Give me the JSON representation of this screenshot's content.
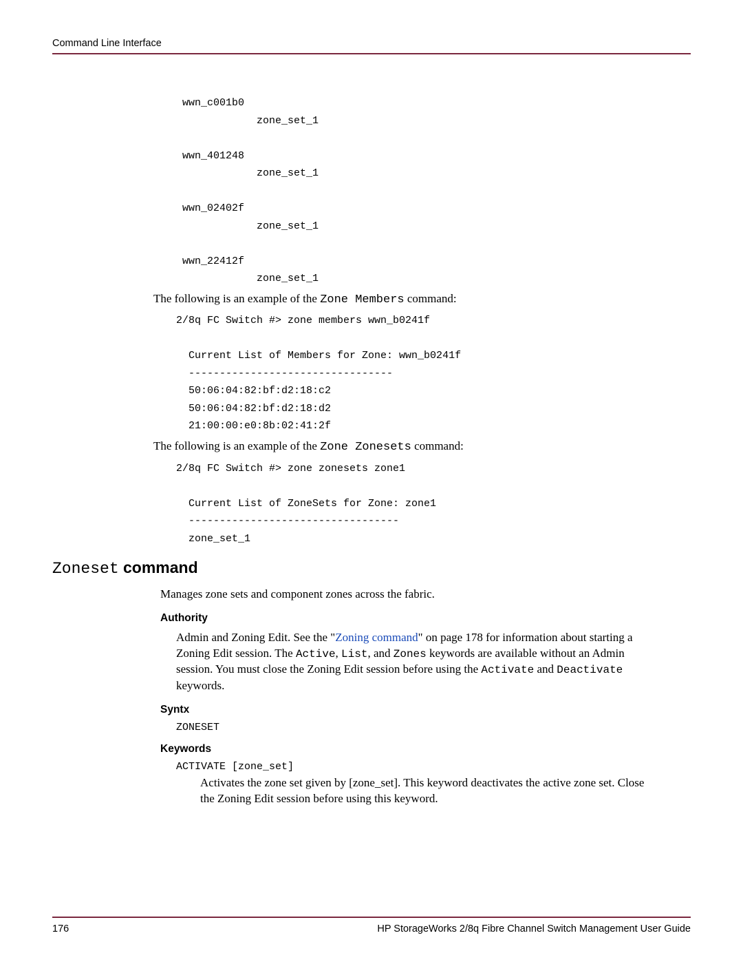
{
  "header": "Command Line Interface",
  "code_block_1": " wwn_c001b0\n             zone_set_1\n\n wwn_401248\n             zone_set_1\n\n wwn_02402f\n             zone_set_1\n\n wwn_22412f\n             zone_set_1",
  "para1_a": "The following is an example of the ",
  "para1_b": "Zone Members",
  "para1_c": " command:",
  "code_block_2": "2/8q FC Switch #> zone members wwn_b0241f\n\n  Current List of Members for Zone: wwn_b0241f\n  ---------------------------------\n  50:06:04:82:bf:d2:18:c2\n  50:06:04:82:bf:d2:18:d2\n  21:00:00:e0:8b:02:41:2f",
  "para2_a": "The following is an example of the ",
  "para2_b": "Zone Zonesets",
  "para2_c": " command:",
  "code_block_3": "2/8q FC Switch #> zone zonesets zone1\n\n  Current List of ZoneSets for Zone: zone1\n  ----------------------------------\n  zone_set_1",
  "section_mono": "Zoneset",
  "section_bold": " command",
  "section_intro": "Manages zone sets and component zones across the fabric.",
  "authority_h": "Authority",
  "authority_a": "Admin and Zoning Edit. See the \"",
  "authority_link": "Zoning command",
  "authority_b": "\" on page 178 for information about starting a Zoning Edit session. The ",
  "authority_m1": "Active",
  "authority_c": ", ",
  "authority_m2": "List",
  "authority_d": ", and ",
  "authority_m3": "Zones",
  "authority_e": " keywords are available without an Admin session. You must close the Zoning Edit session before using the ",
  "authority_m4": "Activate",
  "authority_f": " and ",
  "authority_m5": "Deactivate",
  "authority_g": " keywords.",
  "syntx_h": "Syntx",
  "syntx_code": "ZONESET",
  "keywords_h": "Keywords",
  "keywords_code": "ACTIVATE [zone_set]",
  "keywords_body": "Activates the zone set given by [zone_set]. This keyword deactivates the active zone set. Close the Zoning Edit session before using this keyword.",
  "footer_page": "176",
  "footer_title": "HP StorageWorks 2/8q Fibre Channel Switch Management User Guide"
}
